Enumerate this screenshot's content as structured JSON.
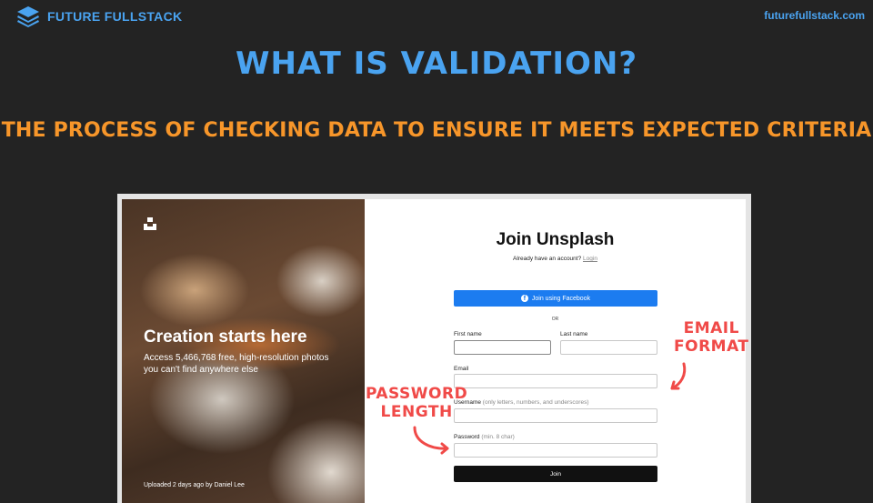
{
  "brand": {
    "name": "FUTURE FULLSTACK",
    "url": "futurefullstack.com",
    "color": "#4aa3f0"
  },
  "slide": {
    "title": "WHAT IS VALIDATION?",
    "subtitle": "THE PROCESS OF CHECKING DATA TO ENSURE IT MEETS EXPECTED CRITERIA",
    "title_color": "#4aa3f0",
    "subtitle_color": "#f7962a"
  },
  "photo": {
    "heading": "Creation starts here",
    "text": "Access 5,466,768 free, high-resolution photos you can't find anywhere else",
    "credit": "Uploaded 2 days ago by Daniel Lee"
  },
  "form": {
    "title": "Join Unsplash",
    "have_account": "Already have an account?",
    "login": "Login",
    "facebook": "Join using Facebook",
    "or": "OR",
    "first_name": "First name",
    "last_name": "Last name",
    "email": "Email",
    "username": "Username",
    "username_hint": "(only letters, numbers, and underscores)",
    "password": "Password",
    "password_hint": "(min. 8 char)",
    "join": "Join"
  },
  "annotations": {
    "email_line1": "EMAIL",
    "email_line2": "FORMAT",
    "password_line1": "PASSWORD",
    "password_line2": "LENGTH",
    "color": "#f04a48"
  }
}
